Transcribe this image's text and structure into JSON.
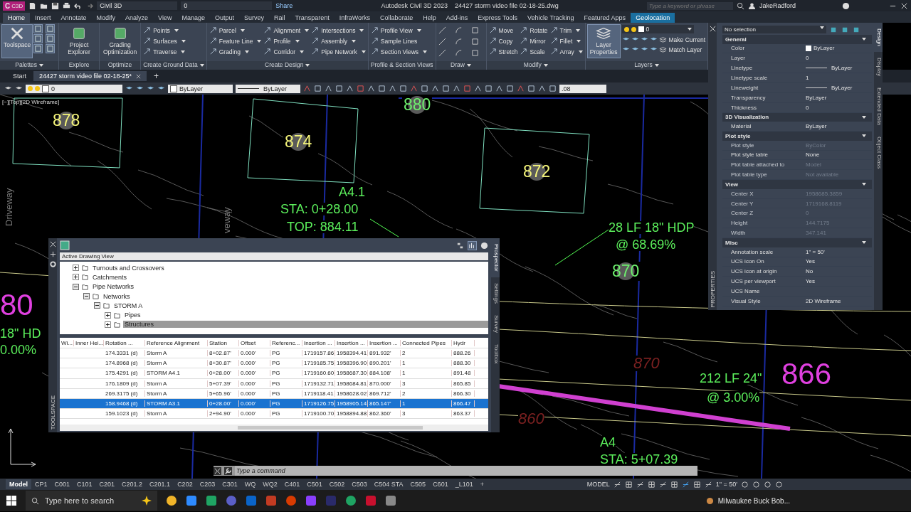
{
  "title_bar": {
    "app_letter": "C",
    "app_badge": "C3D",
    "workspace": "Civil 3D",
    "layer": "0",
    "share": "Share",
    "title": "Autodesk Civil 3D 2023",
    "file": "24427 storm video file 02-18-25.dwg",
    "search_placeholder": "Type a keyword or phrase",
    "user": "JakeRadford"
  },
  "ribbon_tabs": [
    {
      "label": "Home",
      "selected": true,
      "contextual": false
    },
    {
      "label": "Insert",
      "selected": false,
      "contextual": false
    },
    {
      "label": "Annotate",
      "selected": false,
      "contextual": false
    },
    {
      "label": "Modify",
      "selected": false,
      "contextual": false
    },
    {
      "label": "Analyze",
      "selected": false,
      "contextual": false
    },
    {
      "label": "View",
      "selected": false,
      "contextual": false
    },
    {
      "label": "Manage",
      "selected": false,
      "contextual": false
    },
    {
      "label": "Output",
      "selected": false,
      "contextual": false
    },
    {
      "label": "Survey",
      "selected": false,
      "contextual": false
    },
    {
      "label": "Rail",
      "selected": false,
      "contextual": false
    },
    {
      "label": "Transparent",
      "selected": false,
      "contextual": false
    },
    {
      "label": "InfraWorks",
      "selected": false,
      "contextual": false
    },
    {
      "label": "Collaborate",
      "selected": false,
      "contextual": false
    },
    {
      "label": "Help",
      "selected": false,
      "contextual": false
    },
    {
      "label": "Add-ins",
      "selected": false,
      "contextual": false
    },
    {
      "label": "Express Tools",
      "selected": false,
      "contextual": false
    },
    {
      "label": "Vehicle Tracking",
      "selected": false,
      "contextual": false
    },
    {
      "label": "Featured Apps",
      "selected": false,
      "contextual": false
    },
    {
      "label": "Geolocation",
      "selected": false,
      "contextual": true
    }
  ],
  "ribbon_panels": [
    {
      "kind": "palettes",
      "title": "Palettes",
      "dropdown": true,
      "large": [
        {
          "label": "Toolspace",
          "active": true
        }
      ]
    },
    {
      "kind": "buttons",
      "title": "Explore",
      "dropdown": false,
      "large": [
        {
          "label": "Project Explorer",
          "active": false
        }
      ]
    },
    {
      "kind": "buttons",
      "title": "Optimize",
      "dropdown": false,
      "large": [
        {
          "label": "Grading Optimization",
          "active": false
        }
      ]
    },
    {
      "kind": "buttons",
      "title": "Create Ground Data",
      "dropdown": true,
      "small": [
        {
          "label": "Points",
          "dropdown": true
        },
        {
          "label": "Surfaces",
          "dropdown": true
        },
        {
          "label": "Traverse",
          "dropdown": true
        }
      ]
    },
    {
      "kind": "buttons",
      "title": "Create Design",
      "dropdown": true,
      "small": [
        {
          "label": "Parcel",
          "dropdown": true
        },
        {
          "label": "Feature Line",
          "dropdown": true
        },
        {
          "label": "Grading",
          "dropdown": true
        },
        {
          "label": "Alignment",
          "dropdown": true
        },
        {
          "label": "Profile",
          "dropdown": true
        },
        {
          "label": "Corridor",
          "dropdown": true
        },
        {
          "label": "Intersections",
          "dropdown": true
        },
        {
          "label": "Assembly",
          "dropdown": true
        },
        {
          "label": "Pipe Network",
          "dropdown": true
        }
      ]
    },
    {
      "kind": "buttons",
      "title": "Profile & Section Views",
      "dropdown": false,
      "small": [
        {
          "label": "Profile View",
          "dropdown": true
        },
        {
          "label": "Sample Lines",
          "dropdown": false
        },
        {
          "label": "Section Views",
          "dropdown": true
        }
      ]
    },
    {
      "kind": "draw",
      "title": "Draw",
      "dropdown": true
    },
    {
      "kind": "buttons",
      "title": "Modify",
      "dropdown": true,
      "small": [
        {
          "label": "Move",
          "dropdown": false
        },
        {
          "label": "Copy",
          "dropdown": false
        },
        {
          "label": "Stretch",
          "dropdown": false
        },
        {
          "label": "Rotate",
          "dropdown": false
        },
        {
          "label": "Mirror",
          "dropdown": false
        },
        {
          "label": "Scale",
          "dropdown": false
        },
        {
          "label": "Trim",
          "dropdown": true
        },
        {
          "label": "Fillet",
          "dropdown": true
        },
        {
          "label": "Array",
          "dropdown": true
        }
      ]
    },
    {
      "kind": "layers",
      "title": "Layers",
      "dropdown": true,
      "layer": "0",
      "large": [
        {
          "label": "Layer Properties",
          "active": true
        }
      ],
      "small": [
        {
          "label": "Make Current",
          "dropdown": false
        },
        {
          "label": "Match Layer",
          "dropdown": false
        }
      ]
    }
  ],
  "file_tabs": [
    {
      "label": "Start",
      "selected": false
    },
    {
      "label": "24427 storm video file 02-18-25*",
      "selected": true
    }
  ],
  "file_tab_add": "+",
  "properties_toolbar": {
    "layer": "0",
    "color_value": "ByLayer",
    "linetype": "ByLayer",
    "value": ".08"
  },
  "canvas": {
    "view_label": "[−][Top][2D Wireframe]",
    "labels": [
      {
        "text": "878",
        "kind": "lot"
      },
      {
        "text": "874",
        "kind": "lot"
      },
      {
        "text": "880",
        "kind": "lot_green"
      },
      {
        "text": "872",
        "kind": "lot"
      },
      {
        "text": "A4.1",
        "kind": "green"
      },
      {
        "text": "STA: 0+28.00",
        "kind": "green"
      },
      {
        "text": "TOP: 884.11",
        "kind": "green"
      },
      {
        "text": "28 LF 18\" HDP",
        "kind": "green"
      },
      {
        "text": "@ 68.69%",
        "kind": "green"
      },
      {
        "text": "870",
        "kind": "lot_green"
      },
      {
        "text": "80",
        "kind": "magenta"
      },
      {
        "text": "18\" HD",
        "kind": "green"
      },
      {
        "text": "0.00%",
        "kind": "green"
      },
      {
        "text": "870",
        "kind": "faded"
      },
      {
        "text": "860",
        "kind": "faded"
      },
      {
        "text": "212 LF 24\"",
        "kind": "green"
      },
      {
        "text": "@ 3.00%",
        "kind": "green"
      },
      {
        "text": "866",
        "kind": "magenta"
      },
      {
        "text": "A4",
        "kind": "green"
      },
      {
        "text": "STA: 5+07.39",
        "kind": "green"
      },
      {
        "text": "Driveway",
        "kind": "street"
      },
      {
        "text": "veway",
        "kind": "street"
      }
    ]
  },
  "toolspace": {
    "title": "TOOLSPACE",
    "view": "Active Drawing View",
    "tree": [
      {
        "label": "Turnouts and Crossovers",
        "expanded": false,
        "selected": false
      },
      {
        "label": "Catchments",
        "expanded": false,
        "selected": false
      },
      {
        "label": "Pipe Networks",
        "expanded": true,
        "selected": false,
        "children": [
          {
            "label": "Networks",
            "expanded": true,
            "selected": false,
            "children": [
              {
                "label": "STORM A",
                "expanded": true,
                "selected": false,
                "children": [
                  {
                    "label": "Pipes",
                    "expanded": false,
                    "selected": false
                  },
                  {
                    "label": "Structures",
                    "expanded": false,
                    "selected": true
                  }
                ]
              }
            ]
          }
        ]
      }
    ],
    "columns": [
      "Wi...",
      "Inner Hei...",
      "Rotation ...",
      "Reference Alignment",
      "Station",
      "Offset",
      "Referenc...",
      "Insertion ...",
      "Insertion ...",
      "Insertion ...",
      "Connected Pipes",
      "Hydr"
    ],
    "rows": [
      {
        "selected": false,
        "cells": [
          "",
          "",
          "174.3331 (d)",
          "Storm A",
          "8+02.87'",
          "0.000'",
          "PG",
          "1719157.86",
          "1958394.41",
          "891.932'",
          "2",
          "888.26"
        ]
      },
      {
        "selected": false,
        "cells": [
          "",
          "",
          "174.8968 (d)",
          "Storm A",
          "8+30.87'",
          "0.000'",
          "PG",
          "1719185.75",
          "1958396.90",
          "890.201'",
          "1",
          "888.30"
        ]
      },
      {
        "selected": false,
        "cells": [
          "",
          "",
          "175.4291 (d)",
          "STORM A4.1",
          "0+28.00'",
          "0.000'",
          "PG",
          "1719160.60",
          "1958687.30",
          "884.108'",
          "1",
          "891.48"
        ]
      },
      {
        "selected": false,
        "cells": [
          "",
          "",
          "176.1809 (d)",
          "Storm A",
          "5+07.39'",
          "0.000'",
          "PG",
          "1719132.71",
          "1958684.81",
          "870.000'",
          "3",
          "865.85"
        ]
      },
      {
        "selected": false,
        "cells": [
          "",
          "",
          "269.3175 (d)",
          "Storm A",
          "5+65.96'",
          "0.000'",
          "PG",
          "1719118.41",
          "1958628.02",
          "869.712'",
          "2",
          "866.30"
        ]
      },
      {
        "selected": true,
        "cells": [
          "",
          "",
          "158.9468 (d)",
          "STORM A3.1",
          "0+28.00'",
          "0.000'",
          "PG",
          "1719126.75",
          "1958905.14",
          "865.147'",
          "1",
          "866.47"
        ]
      },
      {
        "selected": false,
        "cells": [
          "",
          "",
          "159.1023 (d)",
          "Storm A",
          "2+94.90'",
          "0.000'",
          "PG",
          "1719100.70",
          "1958894.88",
          "862.360'",
          "3",
          "863.37"
        ]
      }
    ],
    "side_tabs": [
      {
        "label": "Prospector",
        "selected": true
      },
      {
        "label": "Settings",
        "selected": false
      },
      {
        "label": "Survey",
        "selected": false
      },
      {
        "label": "Toolbox",
        "selected": false
      }
    ]
  },
  "properties": {
    "title": "PROPERTIES",
    "selection": "No selection",
    "sections": [
      {
        "title": "General",
        "rows": [
          {
            "label": "Color",
            "value": "ByLayer",
            "kind": "color",
            "disabled": false
          },
          {
            "label": "Layer",
            "value": "0",
            "kind": "text",
            "disabled": false
          },
          {
            "label": "Linetype",
            "value": "ByLayer",
            "kind": "line",
            "disabled": false
          },
          {
            "label": "Linetype scale",
            "value": "1",
            "kind": "text",
            "disabled": false
          },
          {
            "label": "Lineweight",
            "value": "ByLayer",
            "kind": "line",
            "disabled": false
          },
          {
            "label": "Transparency",
            "value": "ByLayer",
            "kind": "text",
            "disabled": false
          },
          {
            "label": "Thickness",
            "value": "0",
            "kind": "text",
            "disabled": false
          }
        ]
      },
      {
        "title": "3D Visualization",
        "rows": [
          {
            "label": "Material",
            "value": "ByLayer",
            "kind": "text",
            "disabled": false
          }
        ]
      },
      {
        "title": "Plot style",
        "rows": [
          {
            "label": "Plot style",
            "value": "ByColor",
            "kind": "text",
            "disabled": true
          },
          {
            "label": "Plot style table",
            "value": "None",
            "kind": "text",
            "disabled": false
          },
          {
            "label": "Plot table attached to",
            "value": "Model",
            "kind": "text",
            "disabled": true
          },
          {
            "label": "Plot table type",
            "value": "Not available",
            "kind": "text",
            "disabled": true
          }
        ]
      },
      {
        "title": "View",
        "rows": [
          {
            "label": "Center X",
            "value": "1958685.3859",
            "kind": "text",
            "disabled": true
          },
          {
            "label": "Center Y",
            "value": "1719168.8119",
            "kind": "text",
            "disabled": true
          },
          {
            "label": "Center Z",
            "value": "0",
            "kind": "text",
            "disabled": true
          },
          {
            "label": "Height",
            "value": "144.7175",
            "kind": "text",
            "disabled": true
          },
          {
            "label": "Width",
            "value": "347.141",
            "kind": "text",
            "disabled": true
          }
        ]
      },
      {
        "title": "Misc",
        "rows": [
          {
            "label": "Annotation scale",
            "value": "1\" = 50'",
            "kind": "text",
            "disabled": false
          },
          {
            "label": "UCS icon On",
            "value": "Yes",
            "kind": "text",
            "disabled": false
          },
          {
            "label": "UCS icon at origin",
            "value": "No",
            "kind": "text",
            "disabled": false
          },
          {
            "label": "UCS per viewport",
            "value": "Yes",
            "kind": "text",
            "disabled": false
          },
          {
            "label": "UCS Name",
            "value": "",
            "kind": "text",
            "disabled": false
          },
          {
            "label": "Visual Style",
            "value": "2D Wireframe",
            "kind": "text",
            "disabled": false
          }
        ]
      }
    ],
    "side_tabs": [
      {
        "label": "Design",
        "selected": true
      },
      {
        "label": "Display",
        "selected": false
      },
      {
        "label": "Extended Data",
        "selected": false
      },
      {
        "label": "Object Class",
        "selected": false
      }
    ]
  },
  "command_line": {
    "placeholder": "Type a command"
  },
  "layout_tabs": [
    {
      "label": "Model",
      "selected": true
    },
    {
      "label": "CP1",
      "selected": false
    },
    {
      "label": "C001",
      "selected": false
    },
    {
      "label": "C101",
      "selected": false
    },
    {
      "label": "C201",
      "selected": false
    },
    {
      "label": "C201.2",
      "selected": false
    },
    {
      "label": "C201.1",
      "selected": false
    },
    {
      "label": "C202",
      "selected": false
    },
    {
      "label": "C203",
      "selected": false
    },
    {
      "label": "C301",
      "selected": false
    },
    {
      "label": "WQ",
      "selected": false
    },
    {
      "label": "WQ2",
      "selected": false
    },
    {
      "label": "C401",
      "selected": false
    },
    {
      "label": "C501",
      "selected": false
    },
    {
      "label": "C502",
      "selected": false
    },
    {
      "label": "C503",
      "selected": false
    },
    {
      "label": "C504 STA",
      "selected": false
    },
    {
      "label": "C505",
      "selected": false
    },
    {
      "label": "C601",
      "selected": false
    },
    {
      "label": "_L101",
      "selected": false
    }
  ],
  "layout_tab_add": "+",
  "status_bar": {
    "space": "MODEL",
    "scale": "1\" = 50'"
  },
  "taskbar": {
    "search_placeholder": "Type here to search",
    "news": "Milwaukee Buck Bob..."
  }
}
